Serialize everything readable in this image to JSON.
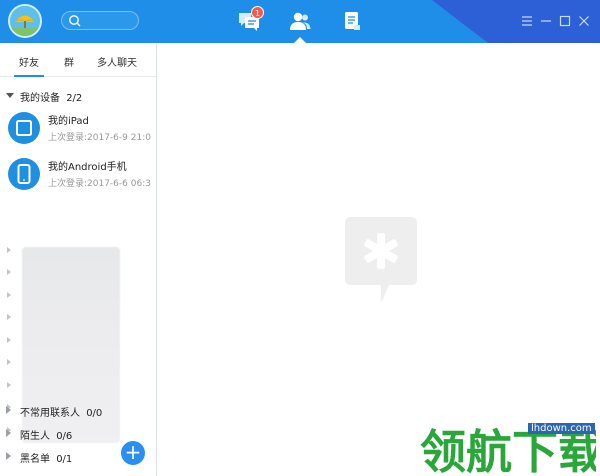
{
  "titlebar": {
    "unread_badge": "1",
    "icons": [
      "avatar-icon",
      "search-icon",
      "messages-icon",
      "contacts-icon",
      "files-icon",
      "menu-icon",
      "minimize-icon",
      "maximize-icon",
      "close-icon"
    ],
    "accent": "#1e8ee8"
  },
  "sidebar": {
    "tabs": [
      "好友",
      "群",
      "多人聊天"
    ],
    "active_tab": "好友",
    "my_devices": {
      "label": "我的设备",
      "count": "2/2",
      "items": [
        {
          "name": "我的iPad",
          "last_login": "上次登录:2017-6-9 21:0"
        },
        {
          "name": "我的Android手机",
          "last_login": "上次登录:2017-6-6 06:3"
        }
      ]
    },
    "groups": [
      {
        "label": "不常用联系人",
        "count": "0/0"
      },
      {
        "label": "陌生人",
        "count": "0/6"
      },
      {
        "label": "黑名单",
        "count": "0/1"
      }
    ],
    "add_button": "+"
  },
  "watermark": {
    "brand": "领航下载",
    "url": "lhdown.com"
  }
}
